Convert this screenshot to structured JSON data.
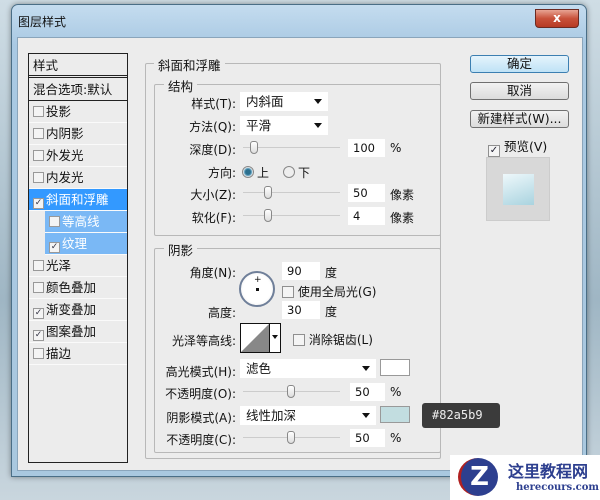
{
  "window": {
    "title": "图层样式",
    "close": "x"
  },
  "sidebar": {
    "header": "样式",
    "blend": "混合选项:默认",
    "items": [
      {
        "label": "投影",
        "checked": false
      },
      {
        "label": "内阴影",
        "checked": false
      },
      {
        "label": "外发光",
        "checked": false
      },
      {
        "label": "内发光",
        "checked": false
      },
      {
        "label": "斜面和浮雕",
        "checked": true,
        "selected": true
      },
      {
        "label": "等高线",
        "checked": false,
        "sub": true
      },
      {
        "label": "纹理",
        "checked": true,
        "sub": true
      },
      {
        "label": "光泽",
        "checked": false
      },
      {
        "label": "颜色叠加",
        "checked": false
      },
      {
        "label": "渐变叠加",
        "checked": true
      },
      {
        "label": "图案叠加",
        "checked": true
      },
      {
        "label": "描边",
        "checked": false
      }
    ]
  },
  "bevel": {
    "title": "斜面和浮雕",
    "structure": {
      "title": "结构",
      "style_label": "样式(T):",
      "style_value": "内斜面",
      "technique_label": "方法(Q):",
      "technique_value": "平滑",
      "depth_label": "深度(D):",
      "depth_value": "100",
      "depth_unit": "%",
      "direction_label": "方向:",
      "dir_up": "上",
      "dir_down": "下",
      "size_label": "大小(Z):",
      "size_value": "50",
      "size_unit": "像素",
      "soften_label": "软化(F):",
      "soften_value": "4",
      "soften_unit": "像素"
    },
    "shading": {
      "title": "阴影",
      "angle_label": "角度(N):",
      "angle_value": "90",
      "angle_unit": "度",
      "global_light": "使用全局光(G)",
      "altitude_label": "高度:",
      "altitude_value": "30",
      "altitude_unit": "度",
      "gloss_label": "光泽等高线:",
      "antialias": "消除锯齿(L)",
      "highlight_label": "高光模式(H):",
      "highlight_mode": "滤色",
      "highlight_color": "#ffffff",
      "hl_opacity_label": "不透明度(O):",
      "hl_opacity": "50",
      "hl_unit": "%",
      "shadow_label": "阴影模式(A):",
      "shadow_mode": "线性加深",
      "shadow_color": "#c2dde0",
      "sh_opacity_label": "不透明度(C):",
      "sh_opacity": "50",
      "sh_unit": "%",
      "tooltip": "#82a5b9"
    }
  },
  "buttons": {
    "ok": "确定",
    "cancel": "取消",
    "new_style": "新建样式(W)...",
    "preview": "预览(V)"
  },
  "watermark": {
    "name": "这里教程网",
    "url": "herecours.com"
  }
}
